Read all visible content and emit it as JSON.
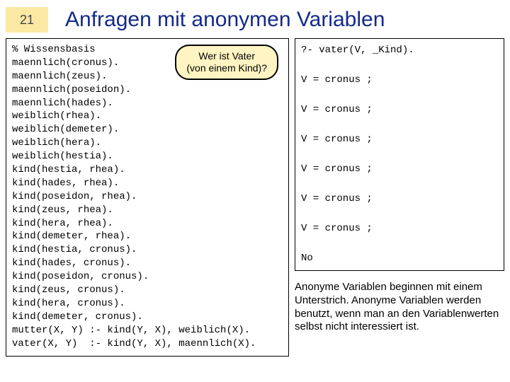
{
  "page_number": "21",
  "title": "Anfragen mit anonymen Variablen",
  "callout": {
    "line1": "Wer ist Vater",
    "line2": "(von einem Kind)?"
  },
  "code_lines": [
    "% Wissensbasis",
    "maennlich(cronus).",
    "maennlich(zeus).",
    "maennlich(poseidon).",
    "maennlich(hades).",
    "weiblich(rhea).",
    "weiblich(demeter).",
    "weiblich(hera).",
    "weiblich(hestia).",
    "kind(hestia, rhea).",
    "kind(hades, rhea).",
    "kind(poseidon, rhea).",
    "kind(zeus, rhea).",
    "kind(hera, rhea).",
    "kind(demeter, rhea).",
    "kind(hestia, cronus).",
    "kind(hades, cronus).",
    "kind(poseidon, cronus).",
    "kind(zeus, cronus).",
    "kind(hera, cronus).",
    "kind(demeter, cronus).",
    "mutter(X, Y) :- kind(Y, X), weiblich(X).",
    "vater(X, Y)  :- kind(Y, X), maennlich(X)."
  ],
  "output_lines": [
    "?- vater(V, _Kind).",
    "",
    "V = cronus ;",
    "",
    "V = cronus ;",
    "",
    "V = cronus ;",
    "",
    "V = cronus ;",
    "",
    "V = cronus ;",
    "",
    "V = cronus ;",
    "",
    "No"
  ],
  "note": "Anonyme Variablen beginnen mit einem Unterstrich. Anonyme Variablen werden benutzt, wenn man an den Variablenwerten selbst nicht interessiert ist."
}
